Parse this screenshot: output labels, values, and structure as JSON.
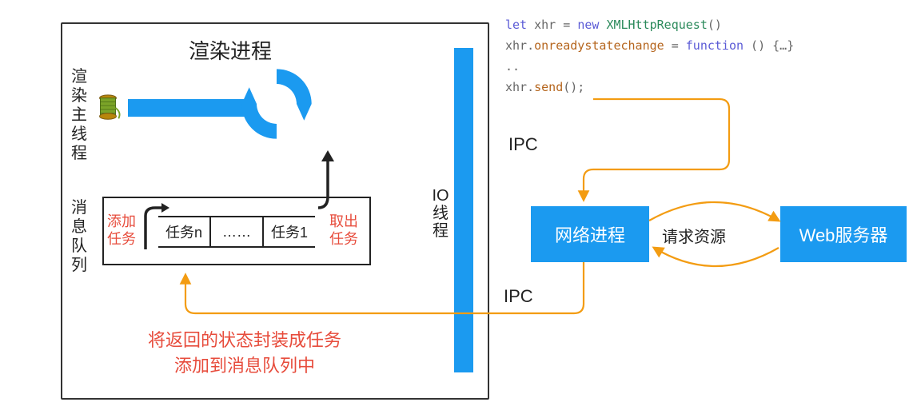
{
  "diagram": {
    "render_process_title": "渲染进程",
    "render_main_thread_label": "渲染主线程",
    "io_thread_label": "IO线程",
    "message_queue_label": "消息队列",
    "queue": {
      "task_n": "任务n",
      "dots": "……",
      "task_1": "任务1"
    },
    "add_task_label": "添加任务",
    "pop_task_label": "取出任务",
    "footer_note_line1": "将返回的状态封装成任务",
    "footer_note_line2": "添加到消息队列中"
  },
  "ipc": {
    "label_send": "IPC",
    "label_recv": "IPC"
  },
  "network": {
    "process_label": "网络进程",
    "request_label": "请求资源",
    "web_server_label": "Web服务器"
  },
  "code": {
    "kw_let": "let",
    "var_xhr": "xhr",
    "kw_new": "new",
    "cls_xhr": "XMLHttpRequest",
    "parens1": "()",
    "prop_onready": "onreadystatechange",
    "kw_function": "function",
    "fn_tail": " () {…}",
    "dots": "..",
    "method_send": "send",
    "send_tail": "();"
  }
}
